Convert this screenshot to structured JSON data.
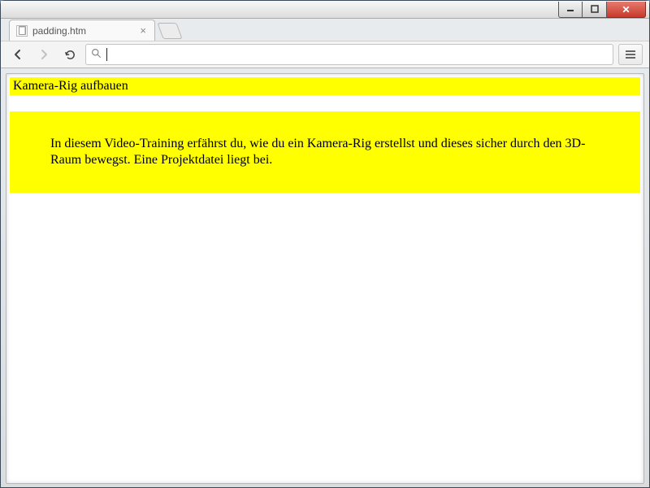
{
  "window": {
    "controls": {
      "min": "minimize",
      "max": "maximize",
      "close": "close"
    }
  },
  "tab": {
    "title": "padding.htm"
  },
  "toolbar": {
    "back": "Back",
    "forward": "Forward",
    "reload": "Reload",
    "address_value": "",
    "menu": "Menu"
  },
  "page": {
    "heading": "Kamera-Rig aufbauen",
    "body": "In diesem Video-Training erfährst du, wie du ein Kamera-Rig erstellst und dieses sicher durch den 3D-Raum bewegst. Eine Projektdatei liegt bei."
  }
}
